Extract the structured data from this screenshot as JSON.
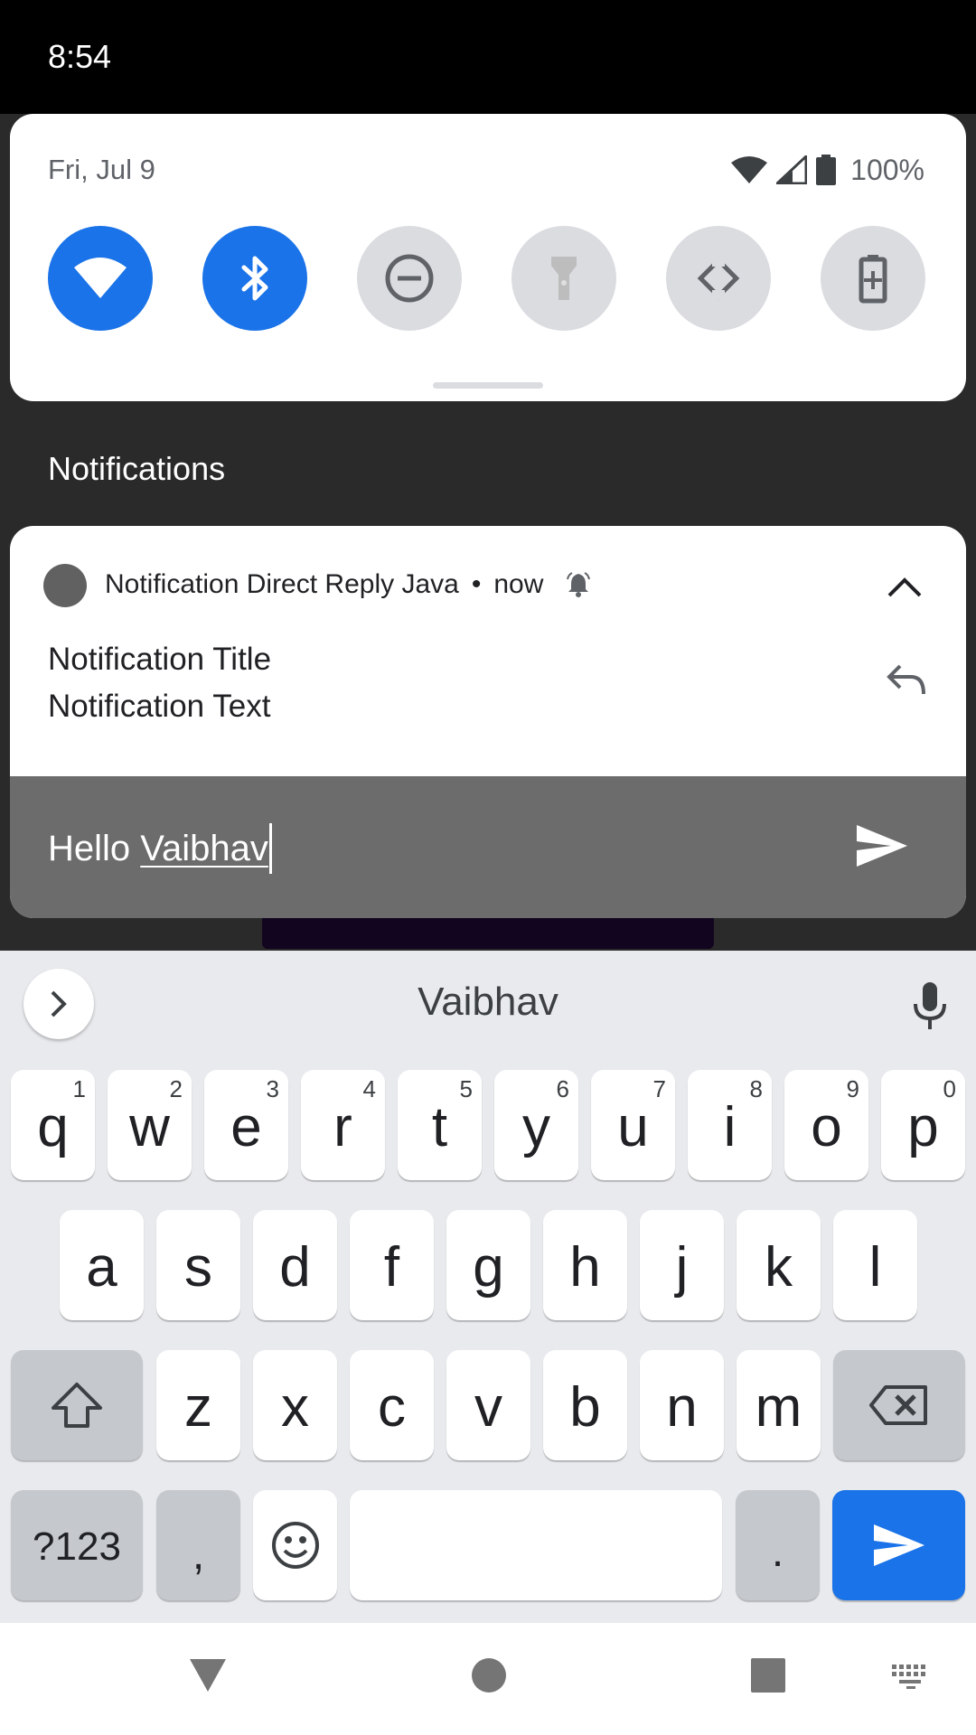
{
  "status_bar": {
    "time": "8:54"
  },
  "quick_settings": {
    "date": "Fri, Jul 9",
    "battery_text": "100%",
    "tiles": [
      {
        "name": "wifi",
        "state": "on"
      },
      {
        "name": "bluetooth",
        "state": "on"
      },
      {
        "name": "do-not-disturb",
        "state": "off"
      },
      {
        "name": "flashlight",
        "state": "off"
      },
      {
        "name": "auto-rotate",
        "state": "off"
      },
      {
        "name": "battery-saver",
        "state": "off"
      }
    ]
  },
  "notifications_heading": "Notifications",
  "notification": {
    "app_name": "Notification Direct Reply Java",
    "separator": "•",
    "time": "now",
    "title": "Notification Title",
    "text": "Notification Text",
    "reply": {
      "prefix": "Hello ",
      "composing_word": "Vaibhav"
    }
  },
  "keyboard": {
    "suggestion": "Vaibhav",
    "row1": [
      {
        "ch": "q",
        "hint": "1"
      },
      {
        "ch": "w",
        "hint": "2"
      },
      {
        "ch": "e",
        "hint": "3"
      },
      {
        "ch": "r",
        "hint": "4"
      },
      {
        "ch": "t",
        "hint": "5"
      },
      {
        "ch": "y",
        "hint": "6"
      },
      {
        "ch": "u",
        "hint": "7"
      },
      {
        "ch": "i",
        "hint": "8"
      },
      {
        "ch": "o",
        "hint": "9"
      },
      {
        "ch": "p",
        "hint": "0"
      }
    ],
    "row2": [
      "a",
      "s",
      "d",
      "f",
      "g",
      "h",
      "j",
      "k",
      "l"
    ],
    "row3": [
      "z",
      "x",
      "c",
      "v",
      "b",
      "n",
      "m"
    ],
    "symbols_label": "?123",
    "comma": ",",
    "period": "."
  },
  "colors": {
    "accent": "#1a73e8",
    "tile_off": "#dadce0",
    "reply_bar": "#6c6c6c",
    "keyboard_bg": "#e8eaed"
  }
}
